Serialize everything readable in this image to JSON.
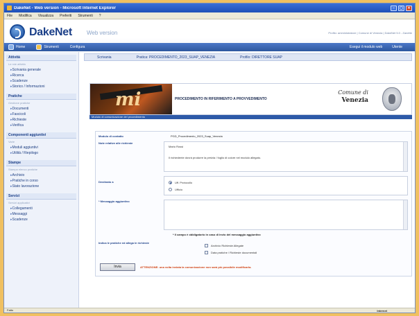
{
  "window": {
    "title": "DakeNet - Web version - Microsoft Internet Explorer"
  },
  "menu": [
    "File",
    "Modifica",
    "Visualizza",
    "Preferiti",
    "Strumenti",
    "?"
  ],
  "header": {
    "brand": "DakeNet",
    "brand_sub": "Web version",
    "right_text": "Profilo: amministratore | Comune di Venezia | DakeNet 5.0 - Zanette",
    "nav": {
      "home": "Home",
      "strumenti": "Strumenti",
      "configura": "Configura"
    },
    "nav_right": {
      "left": "Esegui il modulo web",
      "right": "Utente"
    }
  },
  "sidebar": {
    "sections": [
      {
        "title": "Attività",
        "sub": "Le mie attività",
        "items": [
          "Scrivania generale",
          "Ricerca",
          "Scadenze",
          "Storico / Informazioni"
        ]
      },
      {
        "title": "Pratiche",
        "sub": "Gestione pratiche",
        "items": [
          "Documenti",
          "Fascicoli",
          "Richieste",
          "Verifica"
        ]
      },
      {
        "title": "Componenti aggiuntivi",
        "sub": "Varie",
        "items": [
          "Moduli aggiuntivi",
          "Utilità / Riepilogo"
        ]
      },
      {
        "title": "Stampe",
        "sub": "Stampa elenco pratiche",
        "items": [
          "Archivio",
          "Pratiche in corso",
          "Stato lavorazione"
        ]
      },
      {
        "title": "Servizi",
        "sub": "Servizi applicativi",
        "items": [
          "Collegamenti",
          "Messaggi",
          "Scadenze"
        ]
      }
    ]
  },
  "breadcrumbs": [
    "Scrivania",
    "Pratica: PROCEDIMENTO_2023_SUAP_VENEZIA",
    "Profilo: DIRETTORE SUAP"
  ],
  "banner": {
    "logo_text": "mi",
    "title": "PROCEDIMENTO IN RIFERIMENTO A PROVVEDIMENTO",
    "comune_line1": "Comune di",
    "comune_line2": "Venezia",
    "strip": "Modulo di comunicazione del procedimento"
  },
  "form": {
    "modulo_label": "Modulo di contatto",
    "modulo_value": "PGD_Procedimento_2023_Suap_Venezia",
    "note_label": "Note relative alle richieste",
    "note_value": "Mario Rossi",
    "note_text": "Il richiedente dovrà produrre la perizia / foglio di colore nel modulo allegato.",
    "destinatario_label": "Destinato a",
    "radio_options": [
      "Uff. Protocollo",
      "Ufficio"
    ],
    "messaggio_label": "* Messaggio aggiuntivo",
    "required_note": "* Il campo è obbligatorio in caso di invio del messaggio aggiuntivo",
    "allegati_label": "Indica le pratiche ed allega le richieste",
    "check_options": [
      "Archivio Richieste Allegate",
      "Data pratiche / Richieste documentali"
    ],
    "invia_label": "Invia",
    "warning": "ATTENZIONE: una volta inviata la comunicazione non sarà più possibile modificarla."
  },
  "status": {
    "left": "Fatto",
    "right": "Internet"
  }
}
